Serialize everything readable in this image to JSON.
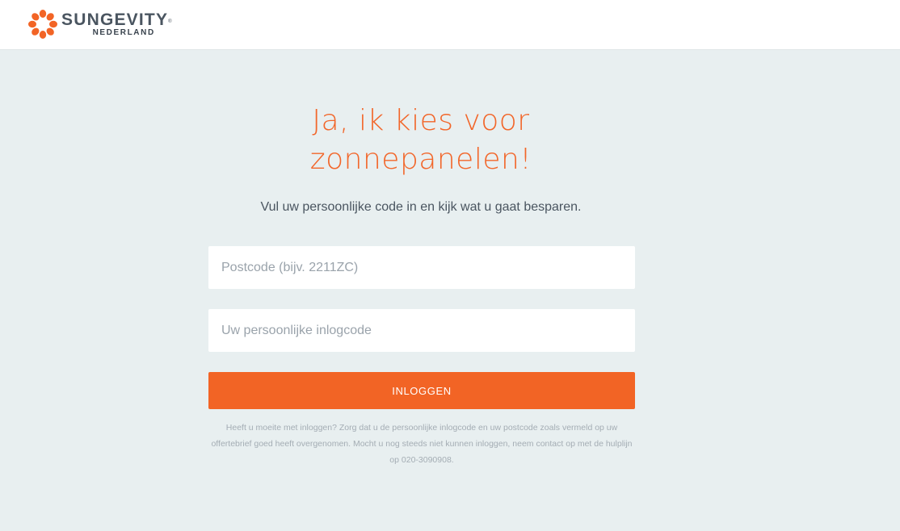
{
  "header": {
    "logo": {
      "brand": "SUNGEVITY",
      "trademark": "®",
      "region": "NEDERLAND",
      "icon": "sun-logo-icon",
      "color": "#f26425"
    }
  },
  "main": {
    "headline_line1": "Ja, ik kies voor",
    "headline_line2": "zonnepanelen!",
    "subtitle": "Vul uw persoonlijke code in en kijk wat u gaat besparen.",
    "form": {
      "postcode_placeholder": "Postcode (bijv. 2211ZC)",
      "postcode_value": "",
      "code_placeholder": "Uw persoonlijke inlogcode",
      "code_value": "",
      "login_label": "INLOGGEN"
    },
    "help_text": "Heeft u moeite met inloggen? Zorg dat u de persoonlijke inlogcode en uw postcode zoals vermeld op uw offertebrief goed heeft overgenomen. Mocht u nog steeds niet kunnen inloggen, neem contact op met de hulplijn op 020-3090908."
  },
  "colors": {
    "accent": "#f26425",
    "background": "#e8eff0",
    "text": "#4a5560"
  }
}
